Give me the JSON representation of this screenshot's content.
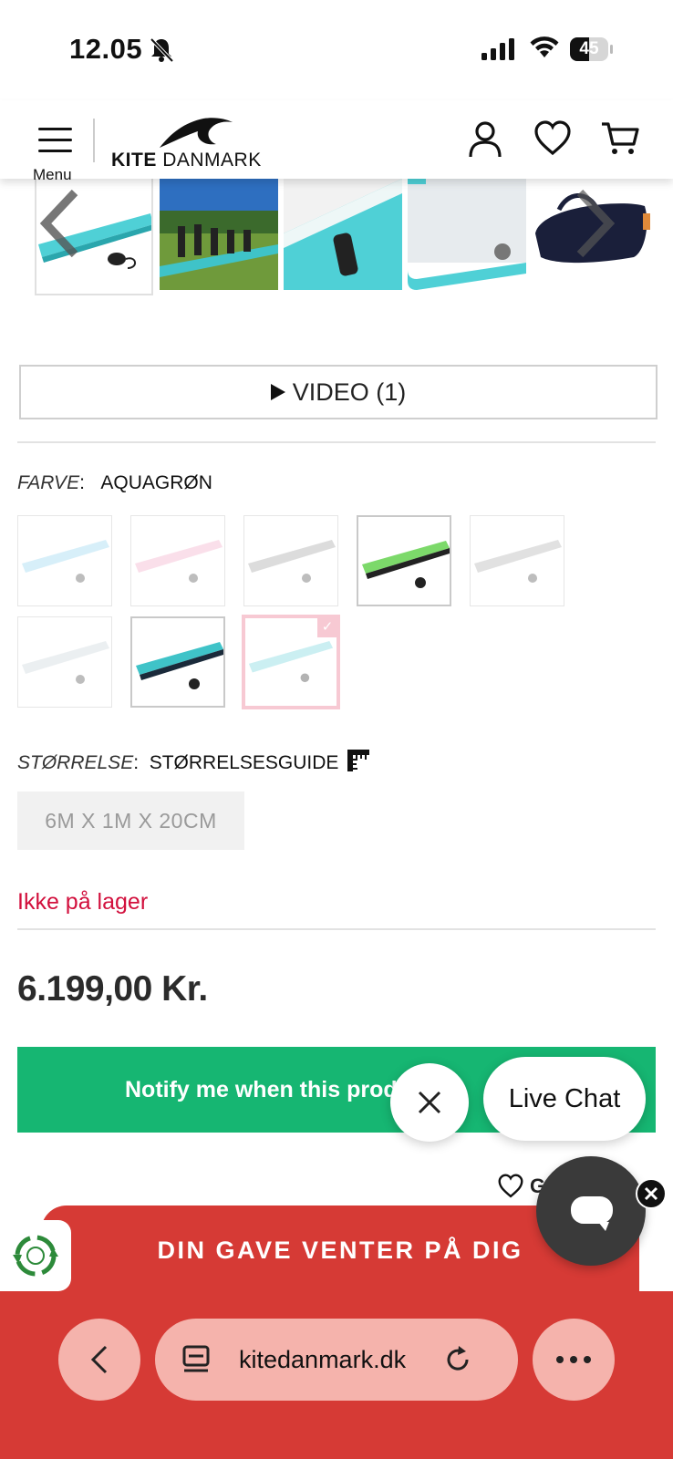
{
  "status_bar": {
    "time": "12.05",
    "battery": "45"
  },
  "header": {
    "menu_label": "Menu",
    "logo_bold": "KITE",
    "logo_light": "DANMARK"
  },
  "video_button": {
    "label": "VIDEO (1)"
  },
  "color_option": {
    "label": "FARVE",
    "value": "AQUAGRØN"
  },
  "size_option": {
    "label": "STØRRELSE",
    "guide_label": "STØRRELSESGUIDE",
    "selected_size": "6M X 1M X 20CM"
  },
  "stock_status": "Ikke på lager",
  "price": "6.199,00 Kr.",
  "notify_button": {
    "label": "Notify me when this prod"
  },
  "live_chat": {
    "label": "Live Chat"
  },
  "wishlist": {
    "label": "G"
  },
  "gift_banner": {
    "label": "DIN GAVE VENTER PÅ DIG"
  },
  "browser": {
    "url": "kitedanmark.dk"
  },
  "colors": {
    "accent_green": "#16b672",
    "stock_red": "#d2103d",
    "banner_red": "#d63a35",
    "aqua": "#4fd0d6"
  }
}
